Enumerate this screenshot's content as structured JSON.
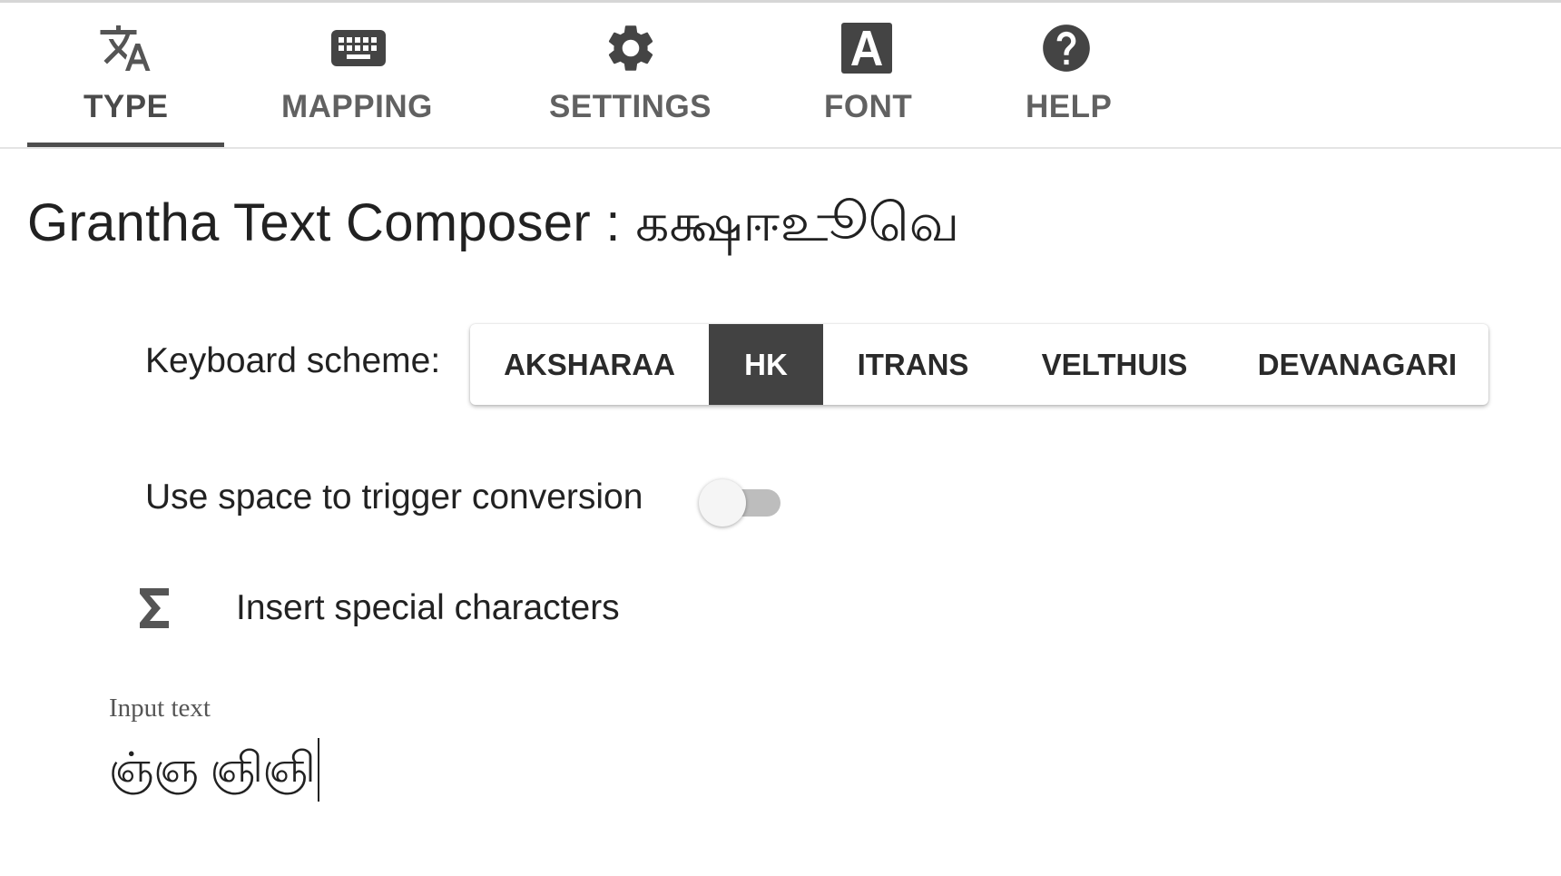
{
  "tabs": [
    {
      "label": "TYPE",
      "icon": "translate-icon",
      "active": true
    },
    {
      "label": "MAPPING",
      "icon": "keyboard-icon",
      "active": false
    },
    {
      "label": "SETTINGS",
      "icon": "gear-icon",
      "active": false
    },
    {
      "label": "FONT",
      "icon": "font-a-icon",
      "active": false
    },
    {
      "label": "HELP",
      "icon": "help-icon",
      "active": false
    }
  ],
  "page": {
    "title": "Grantha Text Composer : கக்ஷஈஉூவெ"
  },
  "keyboard_scheme": {
    "label": "Keyboard scheme:",
    "options": [
      "AKSHARAA",
      "HK",
      "ITRANS",
      "VELTHUIS",
      "DEVANAGARI"
    ],
    "selected": "HK"
  },
  "space_toggle": {
    "label": "Use space to trigger conversion",
    "checked": false
  },
  "special_chars": {
    "label": "Insert special characters",
    "icon": "sigma-icon"
  },
  "input": {
    "label": "Input text",
    "value": "ஞ்ஞ ஞிஞி"
  },
  "colors": {
    "active_tab_indicator": "#4d4d4d",
    "selected_scheme_bg": "#424242",
    "icon_color": "#424242"
  }
}
